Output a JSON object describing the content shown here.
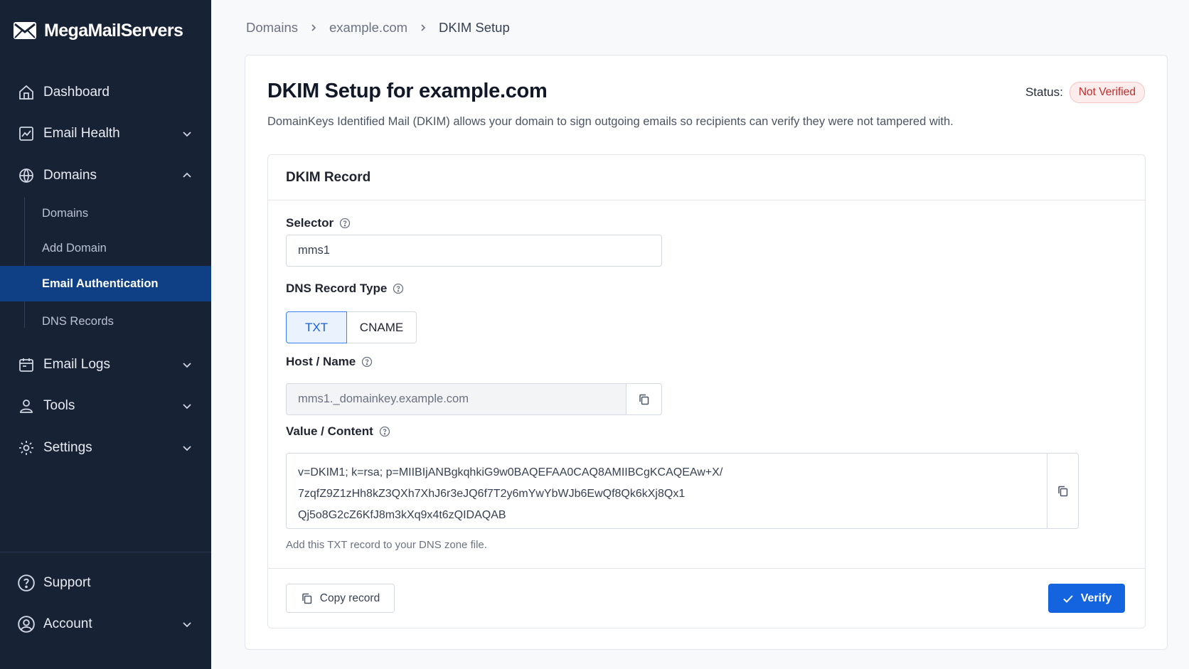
{
  "brand": {
    "name": "MegaMailServers"
  },
  "sidebar": {
    "items": [
      {
        "label": "Dashboard",
        "icon": "home-icon"
      },
      {
        "label": "Email Health",
        "icon": "chart-icon"
      },
      {
        "label": "Domains",
        "icon": "globe-icon"
      },
      {
        "label": "Email Logs",
        "icon": "logs-icon"
      },
      {
        "label": "Tools",
        "icon": "user-icon"
      },
      {
        "label": "Settings",
        "icon": "gear-icon"
      }
    ],
    "sub_items": [
      {
        "label": "Domains"
      },
      {
        "label": "Add Domain"
      },
      {
        "label": "Email Authentication"
      },
      {
        "label": "DNS Records"
      }
    ],
    "footer_items": [
      {
        "label": "Support",
        "icon": "help-circle-icon"
      },
      {
        "label": "Account",
        "icon": "account-icon"
      }
    ]
  },
  "breadcrumb": {
    "items": [
      "Domains",
      "example.com",
      "DKIM Setup"
    ]
  },
  "page": {
    "title": "DKIM Setup for example.com",
    "status_label": "Status:",
    "status": "Not Verified",
    "description": "DomainKeys Identified Mail (DKIM) allows your domain to sign outgoing emails so recipients can verify they were not tampered with."
  },
  "record": {
    "heading": "DKIM Record",
    "selector_label": "Selector",
    "selector_value": "mms1",
    "record_type_label": "DNS Record Type",
    "record_type_options": [
      "TXT",
      "CNAME"
    ],
    "record_type_selected": "TXT",
    "host_label": "Host / Name",
    "host_value": "mms1._domainkey.example.com",
    "value_label": "Value / Content",
    "value_lines": [
      "v=DKIM1; k=rsa; p=MIIBIjANBgkqhkiG9w0BAQEFAA0CAQ8AMIIBCgKCAQEAw+X/",
      "7zqfZ9Z1zHh8kZ3QXh7XhJ6r3eJQ6f7T2y6mYwYbWJb6EwQf8Qk6kXj8Qx1",
      "Qj5o8G2cZ6KfJ8m3kXq9x4t6zQIDAQAB"
    ],
    "helper": "Add this TXT record to your DNS zone file.",
    "copy_record_label": "Copy record",
    "verify_label": "Verify"
  },
  "colors": {
    "sidebar_bg": "#182235",
    "active_item_bg": "#0f3f85",
    "primary": "#1464e0",
    "status_error": "#c42b2b"
  }
}
